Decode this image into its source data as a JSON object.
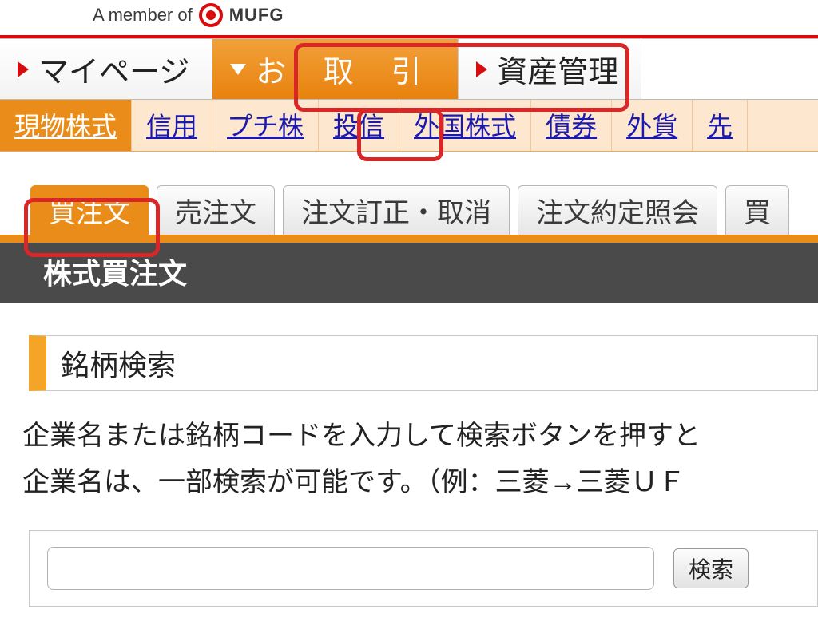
{
  "header": {
    "member_text": "A member of",
    "brand": "MUFG"
  },
  "primary_nav": {
    "items": [
      {
        "label": "マイページ"
      },
      {
        "label": "お 取 引"
      },
      {
        "label": "資産管理"
      }
    ]
  },
  "secondary_nav": {
    "items": [
      {
        "label": "現物株式"
      },
      {
        "label": "信用"
      },
      {
        "label": "プチ株"
      },
      {
        "label": "投信"
      },
      {
        "label": "外国株式"
      },
      {
        "label": "債券"
      },
      {
        "label": "外貨"
      },
      {
        "label": "先"
      }
    ]
  },
  "tabs": {
    "items": [
      {
        "label": "買注文"
      },
      {
        "label": "売注文"
      },
      {
        "label": "注文訂正・取消"
      },
      {
        "label": "注文約定照会"
      },
      {
        "label": "買"
      }
    ]
  },
  "page_title": "株式買注文",
  "section_title": "銘柄検索",
  "instructions": {
    "line1": "企業名または銘柄コードを入力して検索ボタンを押すと",
    "line2": "企業名は、一部検索が可能です。（例：三菱→三菱ＵＦ"
  },
  "search": {
    "value": "",
    "button_label": "検索"
  }
}
